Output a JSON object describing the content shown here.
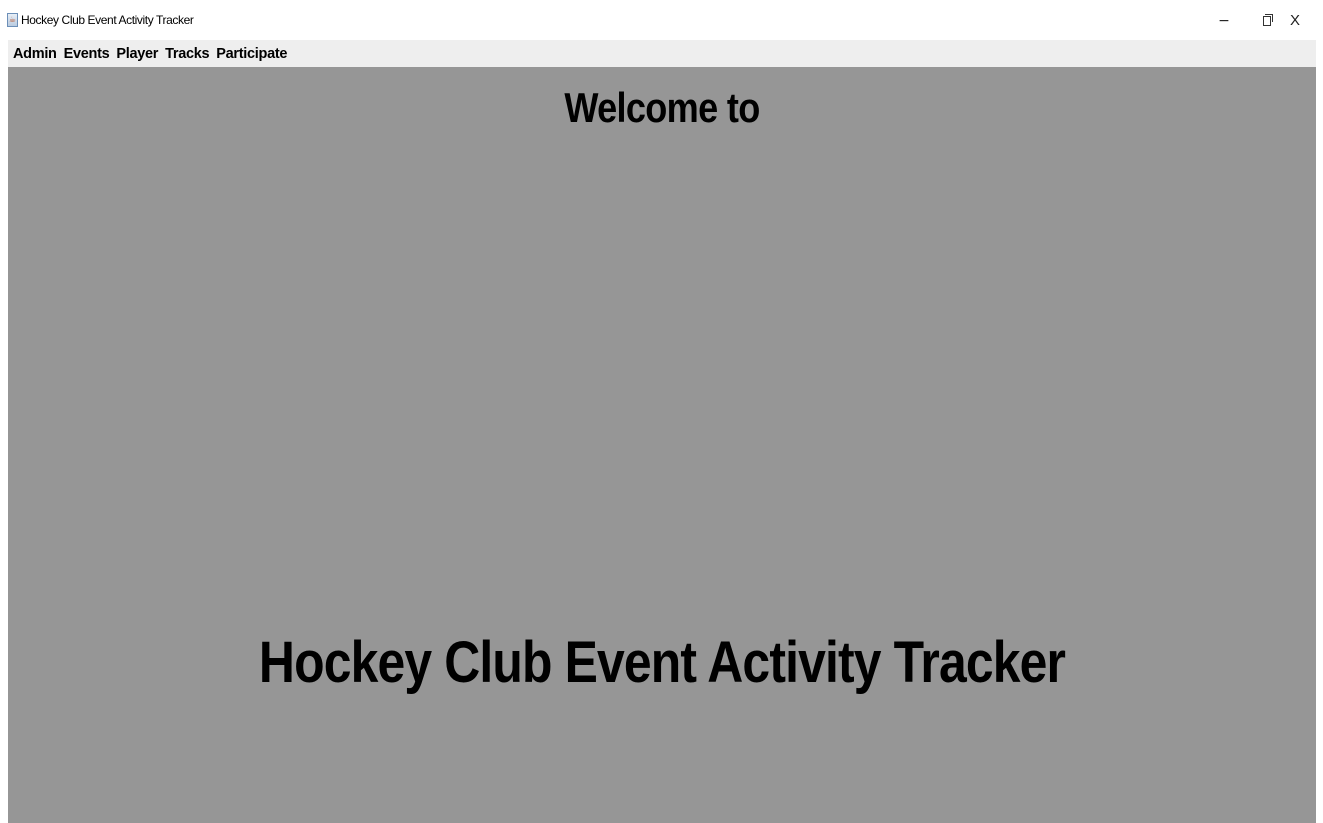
{
  "window": {
    "title": "Hockey Club Event Activity Tracker",
    "icon": "java-cup-icon",
    "controls": {
      "minimize": "−",
      "close": "X"
    }
  },
  "menubar": {
    "items": [
      {
        "label": "Admin"
      },
      {
        "label": "Events"
      },
      {
        "label": "Player"
      },
      {
        "label": "Tracks"
      },
      {
        "label": "Participate"
      }
    ]
  },
  "main": {
    "welcome": "Welcome to",
    "app_name": "Hockey Club Event Activity Tracker"
  },
  "colors": {
    "content_background": "#969696",
    "menubar_background": "#eeeeee",
    "text": "#000000"
  }
}
